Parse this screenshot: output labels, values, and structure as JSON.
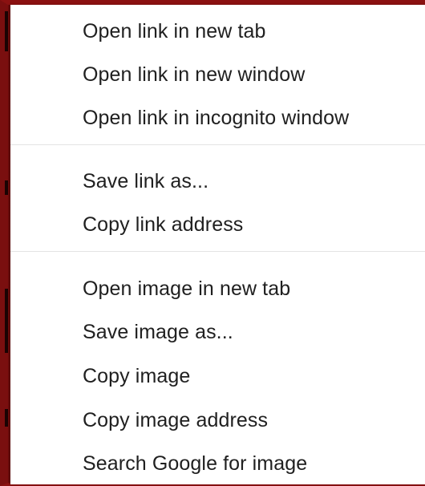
{
  "context_menu": {
    "groups": [
      {
        "items": [
          {
            "label": "Open link in new tab"
          },
          {
            "label": "Open link in new window"
          },
          {
            "label": "Open link in incognito window"
          }
        ]
      },
      {
        "items": [
          {
            "label": "Save link as..."
          },
          {
            "label": "Copy link address"
          }
        ]
      },
      {
        "items": [
          {
            "label": "Open image in new tab"
          },
          {
            "label": "Save image as..."
          },
          {
            "label": "Copy image"
          },
          {
            "label": "Copy image address"
          },
          {
            "label": "Search Google for image"
          }
        ]
      }
    ]
  },
  "colors": {
    "background": "#7a0f0f",
    "menu_bg": "#ffffff",
    "text": "#202020",
    "separator": "#e4e4e4"
  }
}
